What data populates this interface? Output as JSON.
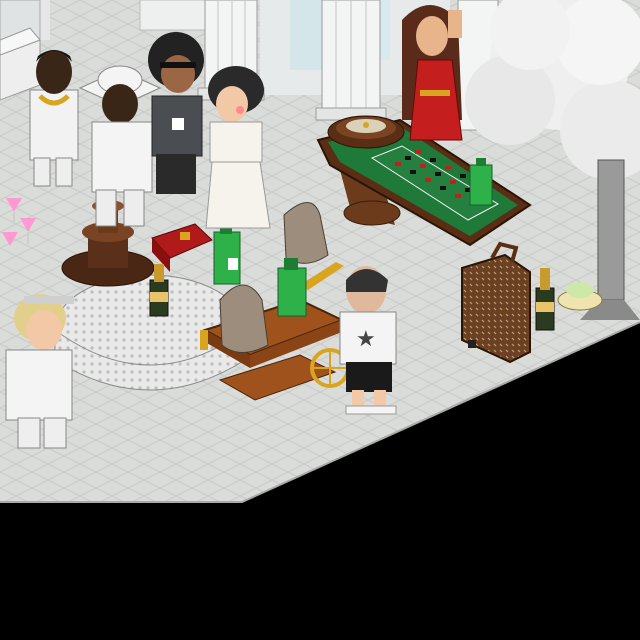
{
  "room": {
    "floor_color": "#d9dbd8",
    "floor_tile_color": "#c9cbc8",
    "void_color": "#000000",
    "wall_color": "#eef0f0",
    "column_color": "#f4f5f5"
  },
  "avatars": [
    {
      "id": "avatar-gold-chain",
      "skin": "#3a2616",
      "outfit": "#f2f2f2",
      "hair": "#151515"
    },
    {
      "id": "avatar-white-hat",
      "skin": "#3a2616",
      "outfit": "#f4f4f4",
      "hair": "#f0f0f0"
    },
    {
      "id": "avatar-curly-sunglasses",
      "skin": "#9a6644",
      "outfit": "#4a4d52",
      "hair": "#222222"
    },
    {
      "id": "avatar-white-dress",
      "skin": "#f2c8a6",
      "outfit": "#f5f3ec",
      "hair": "#2a2a2a"
    },
    {
      "id": "avatar-red-dress",
      "skin": "#e8b48c",
      "outfit": "#c41e1e",
      "hair": "#5a2a1a"
    },
    {
      "id": "avatar-star-shirt",
      "skin": "#f2c8a6",
      "outfit": "#f4f4f4",
      "hair": "#333333"
    },
    {
      "id": "avatar-blonde-white",
      "skin": "#f2c8a6",
      "outfit": "#f4f4f4",
      "hair": "#e3cf8c"
    }
  ],
  "furniture": {
    "roulette_table_color": "#1f7a3a",
    "table_wood_color": "#6b3b1c",
    "cart_wood_color": "#a0521d",
    "brass_color": "#d9a520",
    "suitcase_color": "#6b4126",
    "bottle_green": "#2fb14a",
    "champagne_gold": "#c99a2e",
    "sack_color": "#9c8d7c",
    "chocolate_color": "#5a301a",
    "bag_red": "#b01a1a",
    "tree_blossom": "#f0f0f0"
  }
}
